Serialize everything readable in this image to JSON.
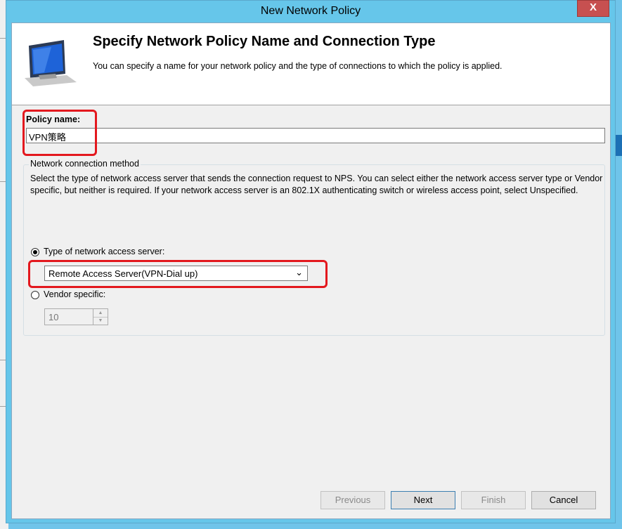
{
  "window": {
    "title": "New Network Policy",
    "close_label": "X"
  },
  "header": {
    "icon": "monitor-icon",
    "title": "Specify Network Policy Name and Connection Type",
    "description": "You can specify a name for your network policy and the type of connections to which the policy is applied."
  },
  "policy_name": {
    "label": "Policy name:",
    "value": "VPN策略"
  },
  "connection_method": {
    "legend": "Network connection method",
    "description": "Select the type of network access server that sends the connection request to NPS. You can select either the network access server type or Vendor specific, but neither is required.  If your network access server is an 802.1X authenticating switch or wireless access point, select Unspecified.",
    "type_option": {
      "label": "Type of network access server:",
      "checked": true
    },
    "type_select": {
      "value": "Remote Access Server(VPN-Dial up)"
    },
    "vendor_option": {
      "label": "Vendor specific:",
      "checked": false
    },
    "vendor_value": "10"
  },
  "buttons": {
    "previous": "Previous",
    "next": "Next",
    "finish": "Finish",
    "cancel": "Cancel"
  },
  "colors": {
    "titlebar": "#66c6ea",
    "close_button": "#c75050",
    "annotation_highlight": "#e3181e"
  }
}
